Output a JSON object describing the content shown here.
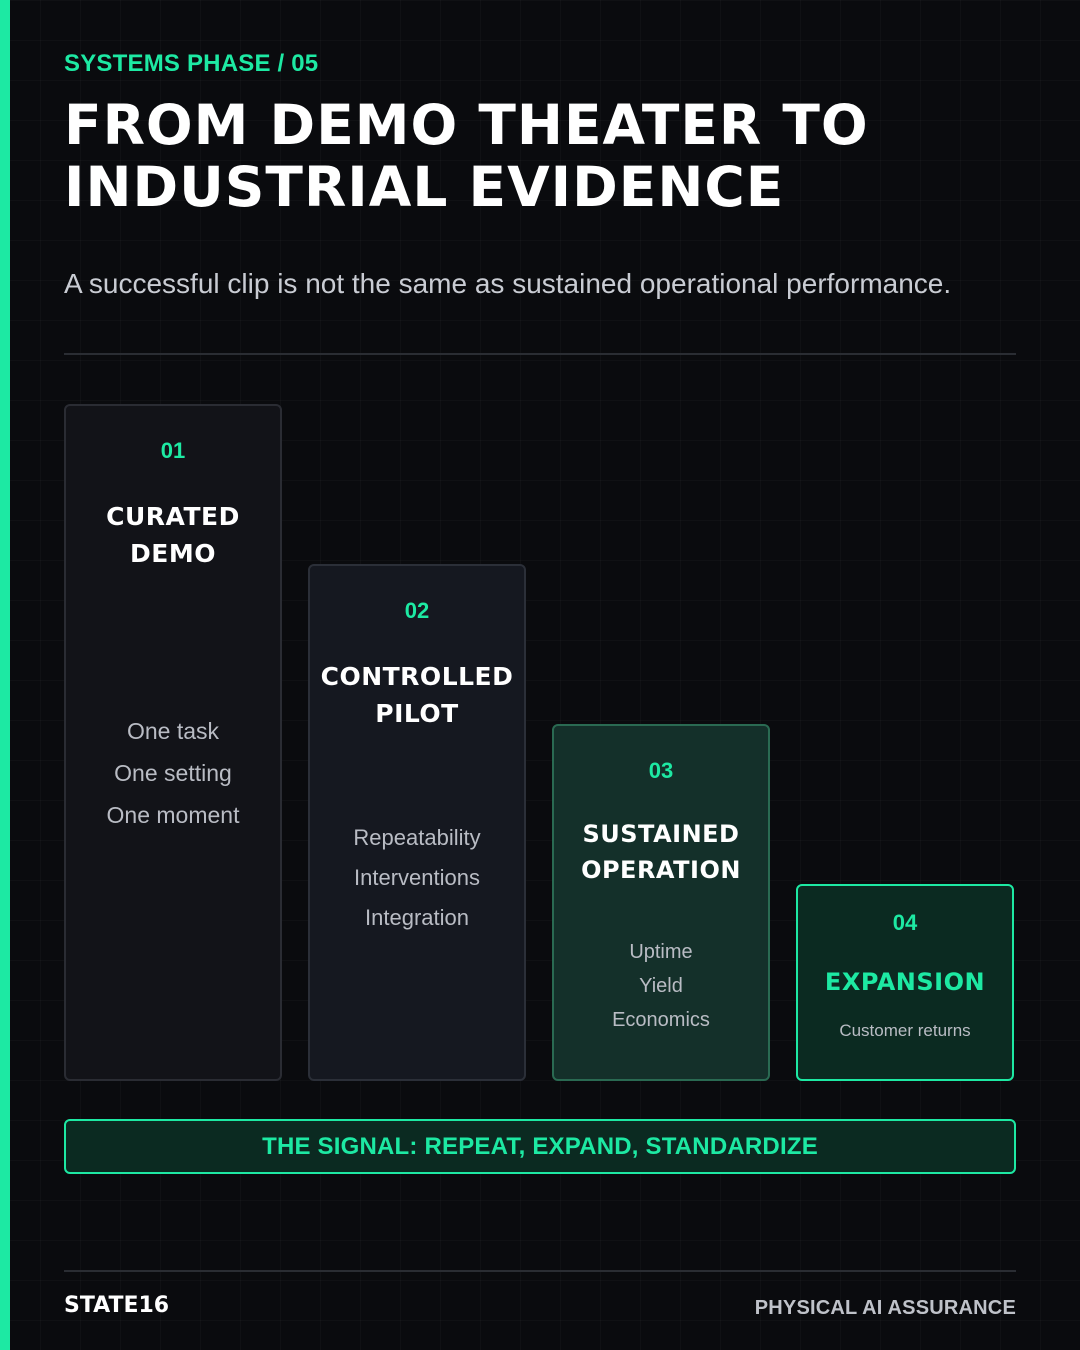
{
  "kicker": "SYSTEMS PHASE / 05",
  "title": {
    "line1": "FROM DEMO THEATER TO",
    "line2": "INDUSTRIAL EVIDENCE"
  },
  "subtitle": "A successful clip is not the same as sustained operational performance.",
  "stages": [
    {
      "number": "01",
      "title_lines": [
        "CURATED",
        "DEMO"
      ],
      "items": [
        "One task",
        "One setting",
        "One moment"
      ]
    },
    {
      "number": "02",
      "title_lines": [
        "CONTROLLED",
        "PILOT"
      ],
      "items": [
        "Repeatability",
        "Interventions",
        "Integration"
      ]
    },
    {
      "number": "03",
      "title_lines": [
        "SUSTAINED",
        "OPERATION"
      ],
      "items": [
        "Uptime",
        "Yield",
        "Economics"
      ]
    },
    {
      "number": "04",
      "title_lines": [
        "EXPANSION"
      ],
      "items": [
        "Customer returns"
      ]
    }
  ],
  "signal": "THE SIGNAL: REPEAT, EXPAND, STANDARDIZE",
  "footer": {
    "brand": "STATE16",
    "tagline": "PHYSICAL AI ASSURANCE"
  },
  "colors": {
    "accent": "#1de9a3",
    "background": "#0a0b0e",
    "text": "#ffffff",
    "muted": "#c9ccd3"
  }
}
